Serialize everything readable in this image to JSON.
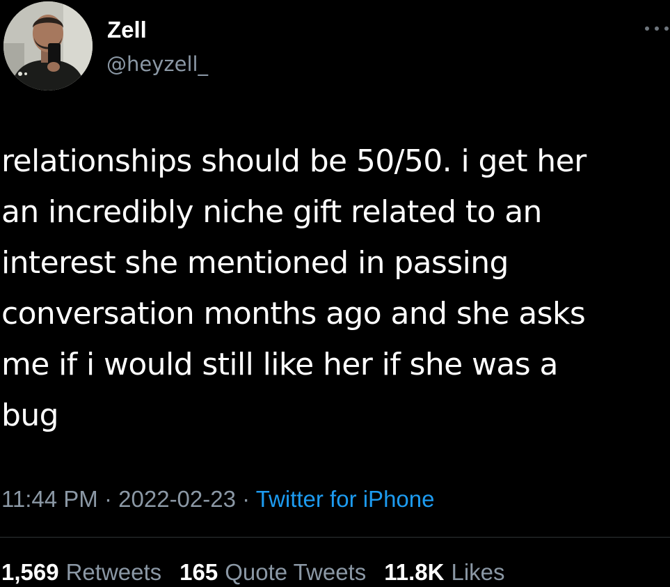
{
  "author": {
    "display_name": "Zell",
    "handle": "@heyzell_",
    "avatar_icon": "profile-photo"
  },
  "header": {
    "more_icon": "more-horizontal-icon"
  },
  "tweet": {
    "text": "relationships should be 50/50. i get her\nan incredibly niche gift related to an\ninterest she mentioned in passing\nconversation months ago and she asks\nme if i would still like her if she was a\nbug"
  },
  "meta": {
    "time": "11:44 PM",
    "separator": "·",
    "date": "2022-02-23",
    "source": "Twitter for iPhone"
  },
  "stats": {
    "retweets_count": "1,569",
    "retweets_label": "Retweets",
    "quote_count": "165",
    "quote_label": "Quote Tweets",
    "likes_count": "11.8K",
    "likes_label": "Likes"
  },
  "colors": {
    "background": "#000000",
    "text_primary": "#ffffff",
    "text_secondary": "#8b98a5",
    "link": "#1d9bf0",
    "divider": "#2f3336"
  }
}
